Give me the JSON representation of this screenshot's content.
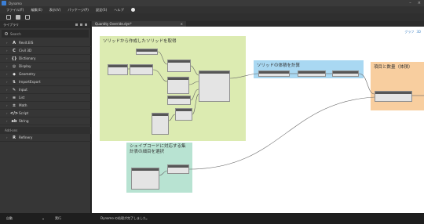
{
  "window": {
    "title": "Dynamo",
    "minimize": "–",
    "close": "×"
  },
  "menu": [
    "ファイル(F)",
    "編集(E)",
    "表示(V)",
    "パッケージ(P)",
    "設定(S)",
    "ヘルプ"
  ],
  "library": {
    "title": "ライブラリ",
    "search_placeholder": "Search",
    "items": [
      {
        "label": "Revit.ElS",
        "icon": "A"
      },
      {
        "label": "Civil 3D",
        "icon": "C"
      },
      {
        "label": "Dictionary",
        "icon": "{}"
      },
      {
        "label": "Display",
        "icon": "◎"
      },
      {
        "label": "Geometry",
        "icon": "◆"
      },
      {
        "label": "ImportExport",
        "icon": "⇅"
      },
      {
        "label": "Input",
        "icon": "✎"
      },
      {
        "label": "List",
        "icon": "≡"
      },
      {
        "label": "Math",
        "icon": "±"
      },
      {
        "label": "Script",
        "icon": "</>"
      },
      {
        "label": "String",
        "icon": "ab"
      }
    ],
    "section": "Add-ons",
    "addons": [
      {
        "label": "Refinery",
        "icon": "R"
      }
    ]
  },
  "tab": {
    "label": "Quantity Override.dyn*",
    "close": "×"
  },
  "canvas": {
    "controls": [
      "グラフ",
      "3D"
    ],
    "groups": {
      "green": "ソリッドから作成したソリッドを取得",
      "blue": "ソリッドの体積を計算",
      "orange": "項目と数量（体積）",
      "teal": "シェイプコードに対応する集計表の細目を選択"
    }
  },
  "status": {
    "run_mode": "自動",
    "run_button": "実行",
    "message": "Dynamo の処理が完了しました。"
  },
  "colors": {
    "group_green": "#dcebb1",
    "group_blue": "#a9d8f2",
    "group_orange": "#f8ce9f",
    "group_teal": "#b8e3d2"
  }
}
